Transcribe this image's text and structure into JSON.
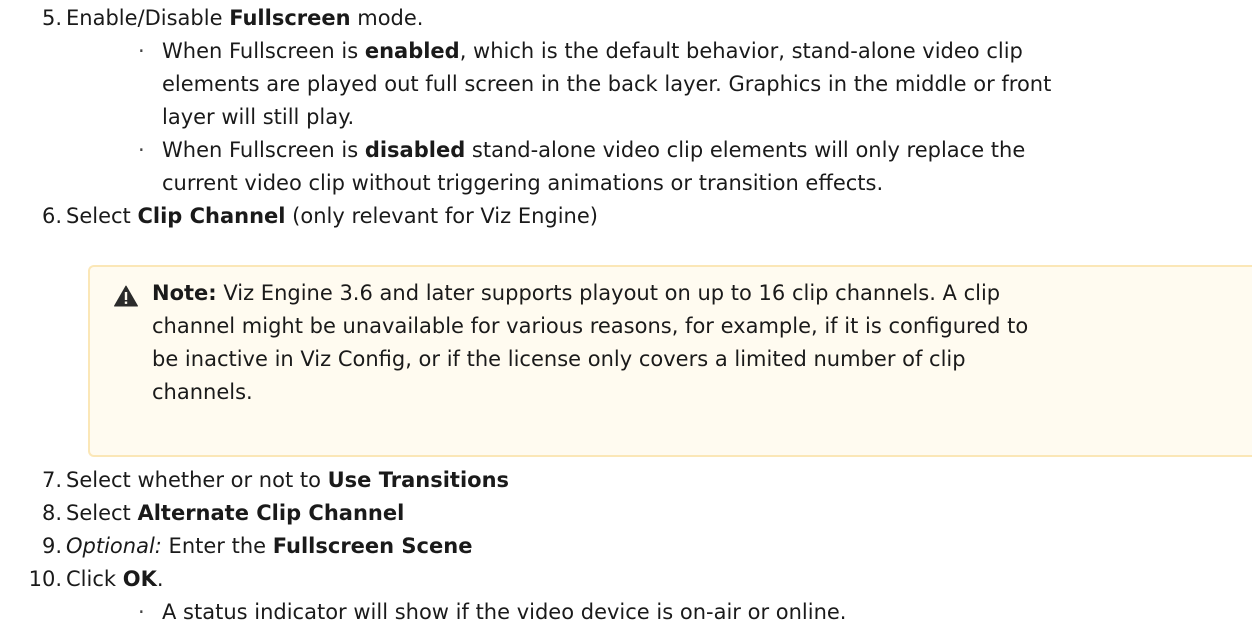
{
  "steps": [
    {
      "num": "5.",
      "pre": "Enable/Disable ",
      "bold": "Fullscreen",
      "post": " mode."
    },
    {
      "num": "6.",
      "pre": "Select ",
      "bold": "Clip Channel",
      "post": " (only relevant for Viz Engine)"
    },
    {
      "num": "7.",
      "pre": "Select whether or not to ",
      "bold": "Use Transitions",
      "post": ""
    },
    {
      "num": "8.",
      "pre": "Select ",
      "bold": "Alternate Clip Channel",
      "post": ""
    },
    {
      "num": "9.",
      "italic": "Optional:",
      "pre": " Enter the ",
      "bold": "Fullscreen Scene",
      "post": ""
    },
    {
      "num": "10.",
      "pre": "Click ",
      "bold": "OK",
      "post": "."
    }
  ],
  "fullscreen_bullets": {
    "enabled": {
      "pre": "When Fullscreen is ",
      "bold": "enabled",
      "line1_post": ", which is the default behavior, stand-alone video clip",
      "line2": "elements are played out full screen in the back layer. Graphics in the middle or front",
      "line3": "layer will still play."
    },
    "disabled": {
      "pre": "When Fullscreen is ",
      "bold": "disabled",
      "line1_post": " stand-alone video clip elements will only replace the",
      "line2": "current video clip without triggering animations or transition effects."
    }
  },
  "note": {
    "label": "Note:",
    "line1": " Viz Engine 3.6 and later supports playout on up to 16 clip channels. A clip",
    "line2": "channel might be unavailable for various reasons, for example, if it is configured to",
    "line3": "be inactive in Viz Config, or if the license only covers a limited number of clip",
    "line4": "channels.",
    "icon": "warning-icon",
    "icon_color": "#2b2b2b"
  },
  "ok_bullet": "A status indicator will show if the video device is on-air or online.",
  "bullet_glyph": "·"
}
